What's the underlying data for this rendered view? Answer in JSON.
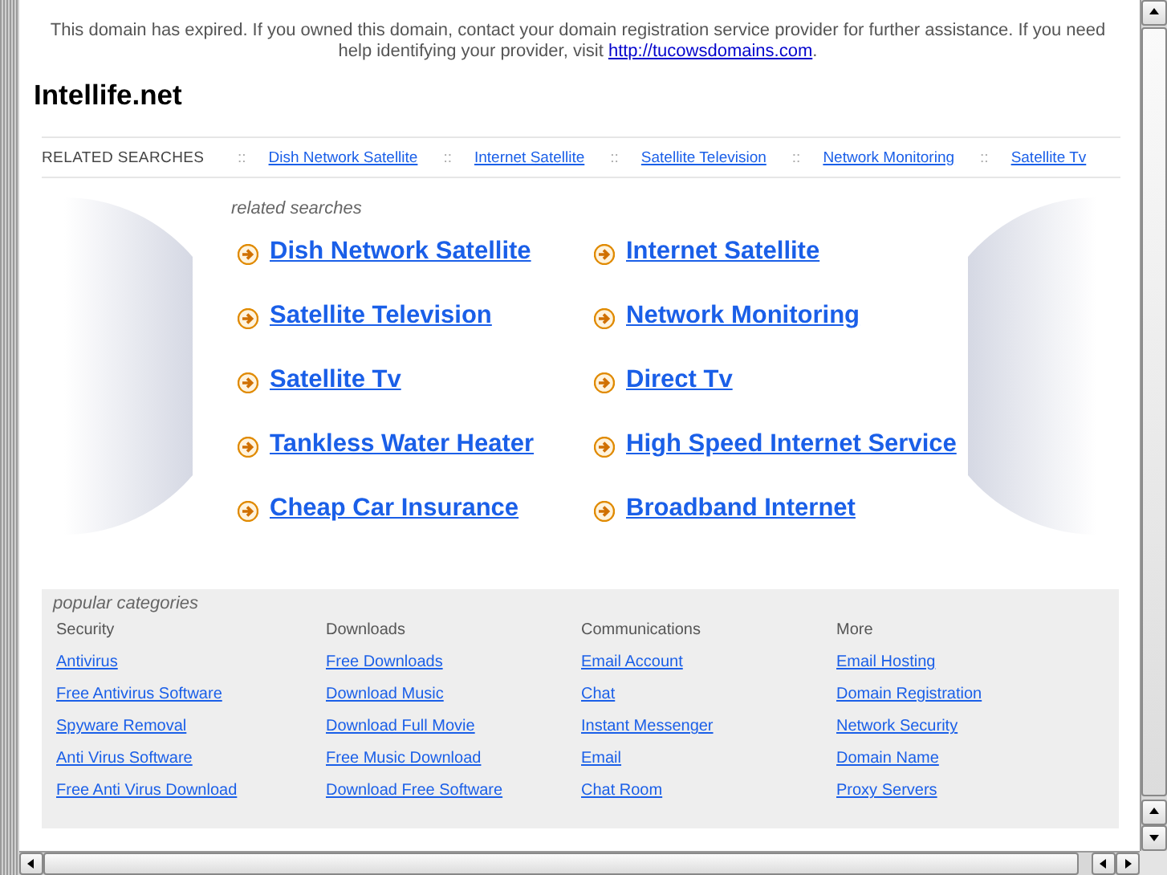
{
  "notice": {
    "text": "This domain has expired. If you owned this domain, contact your domain registration service provider for further assistance. If you need help identifying your provider, visit ",
    "link": "http://tucowsdomains.com",
    "after": "."
  },
  "site_title": "Intellife.net",
  "related_bar": {
    "label": "RELATED SEARCHES",
    "links": [
      {
        "separator": "::",
        "label": "Dish Network Satellite"
      },
      {
        "separator": "::",
        "label": "Internet Satellite"
      },
      {
        "separator": "::",
        "label": "Satellite Television"
      },
      {
        "separator": "::",
        "label": "Network Monitoring"
      },
      {
        "separator": "::",
        "label": "Satellite Tv"
      }
    ]
  },
  "related_searches": {
    "heading": "related searches",
    "links": [
      "Dish Network Satellite",
      "Internet Satellite",
      "Satellite Television",
      "Network Monitoring",
      "Satellite Tv",
      "Direct Tv",
      "Tankless Water Heater",
      "High Speed Internet Service",
      "Cheap Car Insurance",
      "Broadband Internet"
    ]
  },
  "popular_categories": {
    "heading": "popular categories",
    "columns": [
      {
        "title": "Security",
        "links": [
          "Antivirus",
          "Free Antivirus Software",
          "Spyware Removal",
          "Anti Virus Software",
          "Free Anti Virus Download"
        ]
      },
      {
        "title": "Downloads",
        "links": [
          "Free Downloads",
          "Download Music",
          "Download Full Movie",
          "Free Music Download",
          "Download Free Software"
        ]
      },
      {
        "title": "Communications",
        "links": [
          "Email Account",
          "Chat",
          "Instant Messenger",
          "Email",
          "Chat Room"
        ]
      },
      {
        "title": "More",
        "links": [
          "Email Hosting",
          "Domain Registration",
          "Network Security",
          "Domain Name",
          "Proxy Servers"
        ]
      }
    ]
  }
}
